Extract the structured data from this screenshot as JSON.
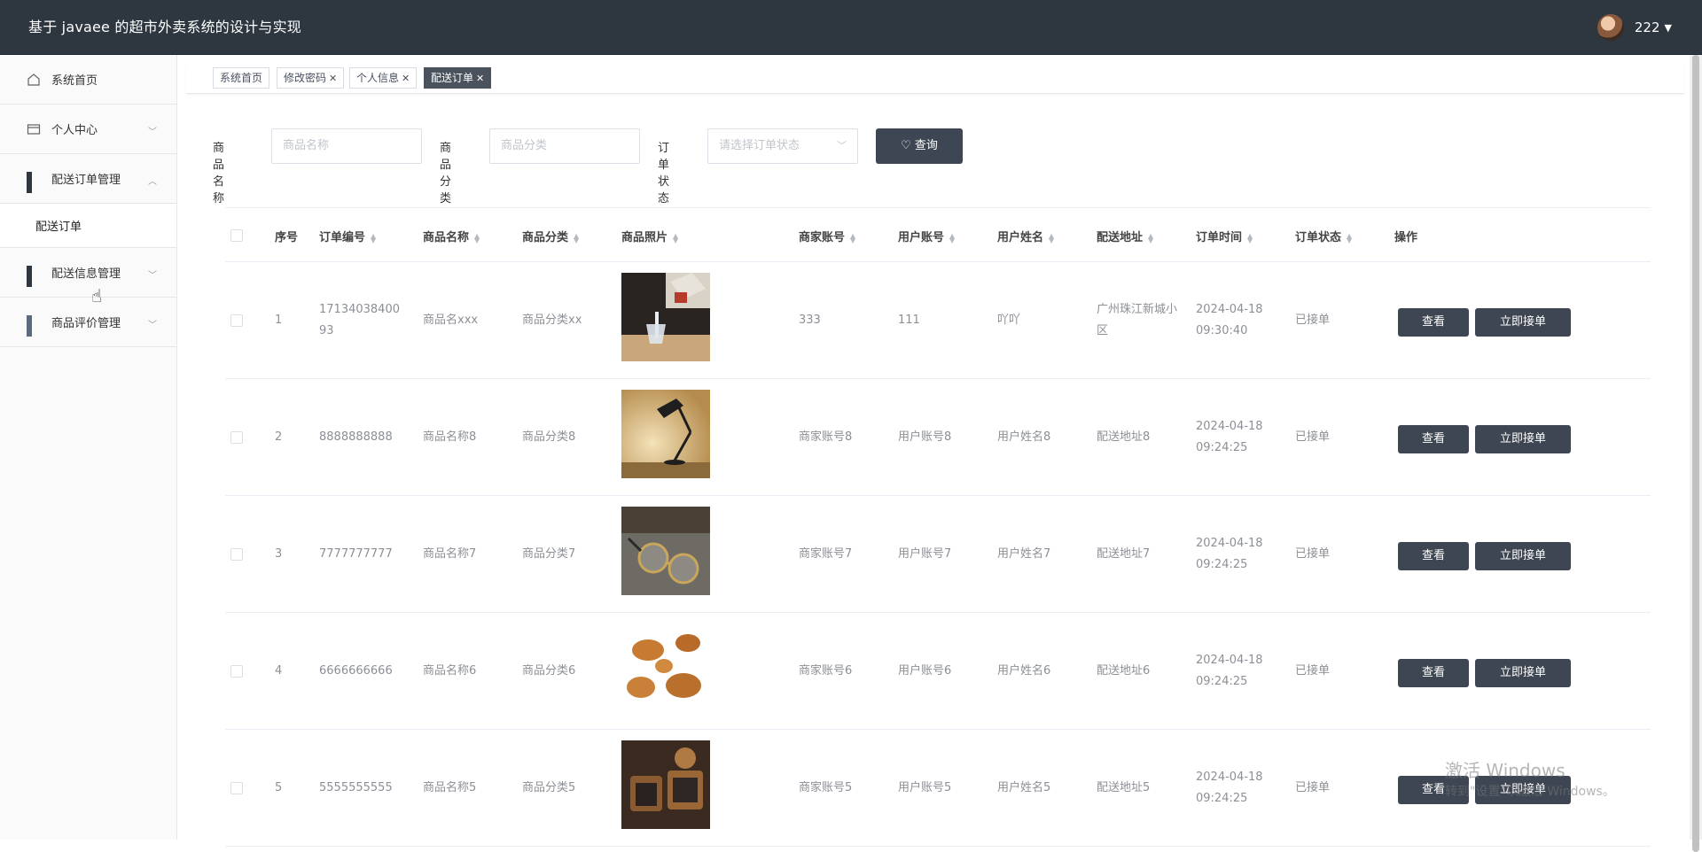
{
  "header": {
    "title": "基于 javaee 的超市外卖系统的设计与实现",
    "username": "222"
  },
  "sidebar": {
    "items": [
      {
        "label": "系统首页"
      },
      {
        "label": "个人中心"
      },
      {
        "label": "配送订单管理"
      },
      {
        "label": "配送订单"
      },
      {
        "label": "配送信息管理"
      },
      {
        "label": "商品评价管理"
      }
    ]
  },
  "tabs": [
    {
      "label": "系统首页"
    },
    {
      "label": "修改密码"
    },
    {
      "label": "个人信息"
    },
    {
      "label": "配送订单"
    }
  ],
  "search": {
    "name_label": "商品名称",
    "name_placeholder": "商品名称",
    "category_label": "商品分类",
    "category_placeholder": "商品分类",
    "status_label": "订单状态",
    "status_placeholder": "请选择订单状态",
    "query_button": "查询"
  },
  "table": {
    "headers": [
      "序号",
      "订单编号",
      "商品名称",
      "商品分类",
      "商品照片",
      "商家账号",
      "用户账号",
      "用户姓名",
      "配送地址",
      "订单时间",
      "订单状态",
      "操作"
    ],
    "rows": [
      {
        "index": "1",
        "order_no": "17134038400 93",
        "name": "商品名xxx",
        "category": "商品分类xx",
        "merchant": "333",
        "user_account": "111",
        "user_name": "吖吖",
        "address": "广州珠江新城小区",
        "time": "2024-04-18 09:30:40",
        "status": "已接单",
        "photo": "baijiu-icon"
      },
      {
        "index": "2",
        "order_no": "8888888888",
        "name": "商品名称8",
        "category": "商品分类8",
        "merchant": "商家账号8",
        "user_account": "用户账号8",
        "user_name": "用户姓名8",
        "address": "配送地址8",
        "time": "2024-04-18 09:24:25",
        "status": "已接单",
        "photo": "desk-lamp-icon"
      },
      {
        "index": "3",
        "order_no": "7777777777",
        "name": "商品名称7",
        "category": "商品分类7",
        "merchant": "商家账号7",
        "user_account": "用户账号7",
        "user_name": "用户姓名7",
        "address": "配送地址7",
        "time": "2024-04-18 09:24:25",
        "status": "已接单",
        "photo": "glasses-icon"
      },
      {
        "index": "4",
        "order_no": "6666666666",
        "name": "商品名称6",
        "category": "商品分类6",
        "merchant": "商家账号6",
        "user_account": "用户账号6",
        "user_name": "用户姓名6",
        "address": "配送地址6",
        "time": "2024-04-18 09:24:25",
        "status": "已接单",
        "photo": "fried-chicken-icon"
      },
      {
        "index": "5",
        "order_no": "5555555555",
        "name": "商品名称5",
        "category": "商品分类5",
        "merchant": "商家账号5",
        "user_account": "用户账号5",
        "user_name": "用户姓名5",
        "address": "配送地址5",
        "time": "2024-04-18 09:24:25",
        "status": "已接单",
        "photo": "mooncake-icon"
      }
    ],
    "view_button": "查看",
    "accept_button": "立即接单"
  },
  "watermark": {
    "line1": "激活 Windows",
    "line2": "转到\"设置\"以激活 Windows。"
  },
  "colors": {
    "header_bg": "#2e3640",
    "button_bg": "#3d4652"
  }
}
